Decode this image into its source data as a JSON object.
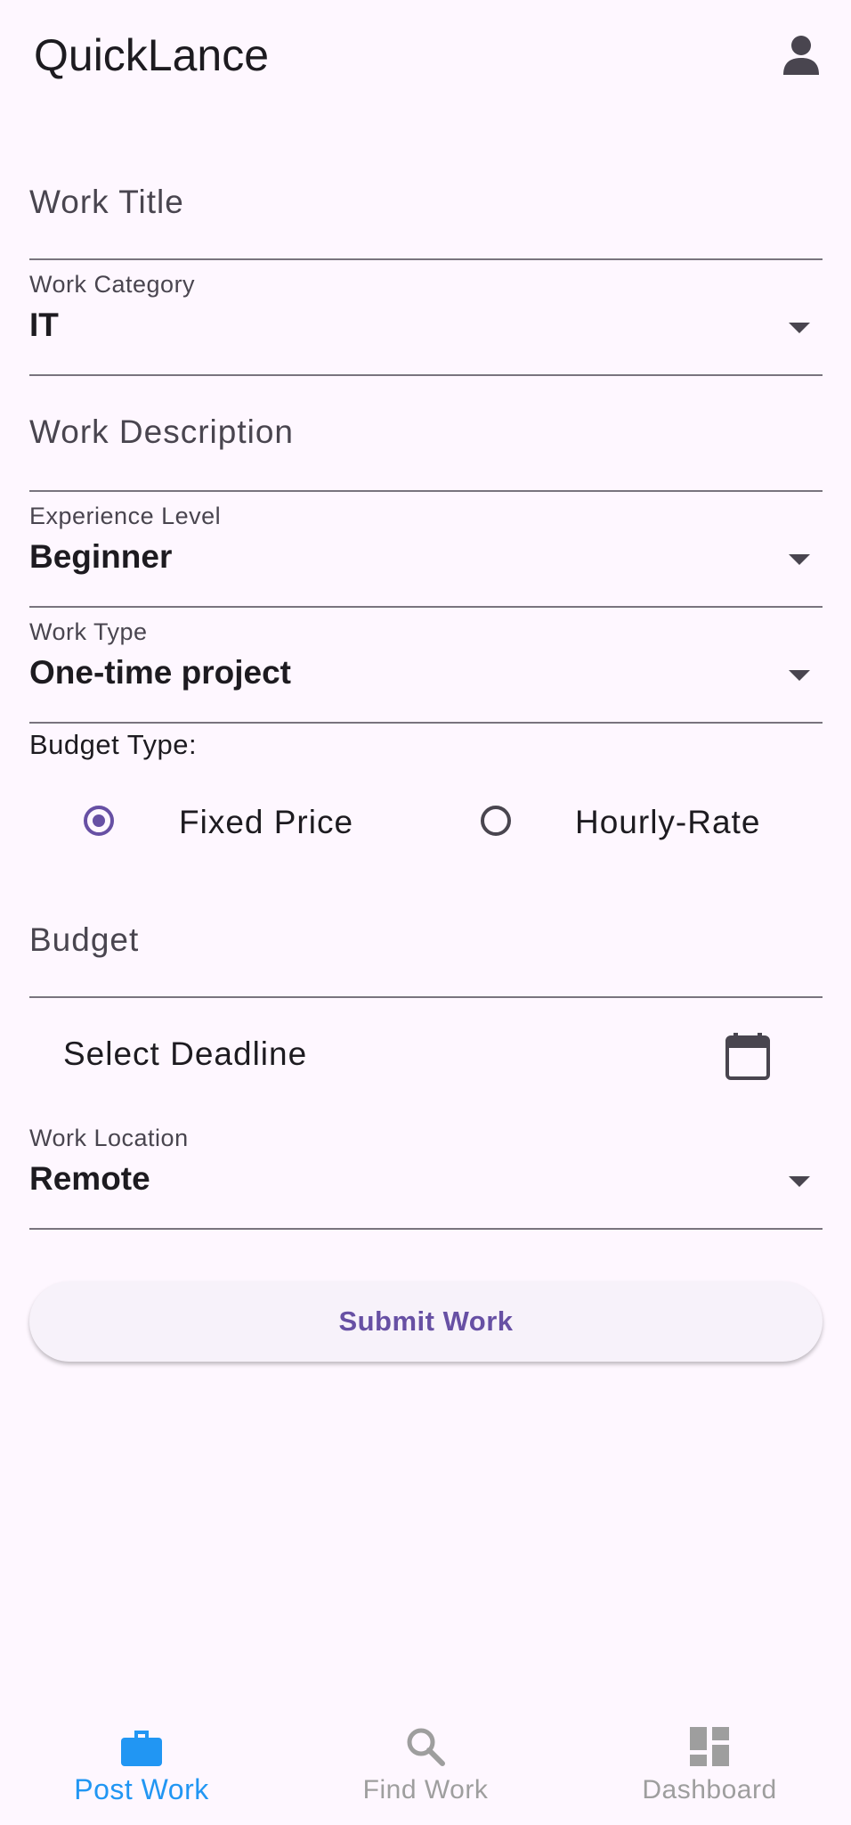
{
  "app": {
    "title": "QuickLance"
  },
  "form": {
    "work_title": {
      "placeholder": "Work Title"
    },
    "work_category": {
      "label": "Work Category",
      "value": "IT"
    },
    "work_description": {
      "placeholder": "Work Description"
    },
    "experience_level": {
      "label": "Experience Level",
      "value": "Beginner"
    },
    "work_type": {
      "label": "Work Type",
      "value": "One-time project"
    },
    "budget_type": {
      "label": "Budget Type:",
      "options": [
        {
          "label": "Fixed Price",
          "selected": true
        },
        {
          "label": "Hourly-Rate",
          "selected": false
        }
      ]
    },
    "budget": {
      "placeholder": "Budget"
    },
    "deadline": {
      "label": "Select Deadline",
      "icon": "calendar-icon"
    },
    "work_location": {
      "label": "Work Location",
      "value": "Remote"
    },
    "submit_label": "Submit Work"
  },
  "nav": {
    "items": [
      {
        "label": "Post Work",
        "icon": "briefcase-icon",
        "active": true
      },
      {
        "label": "Find Work",
        "icon": "search-icon",
        "active": false
      },
      {
        "label": "Dashboard",
        "icon": "dashboard-icon",
        "active": false
      }
    ]
  },
  "colors": {
    "background": "#FEF7FF",
    "primary": "#6750A4",
    "nav_active": "#2196F3",
    "nav_inactive": "#9E9E9E",
    "text": "#1D1B20",
    "muted": "#49454F"
  }
}
